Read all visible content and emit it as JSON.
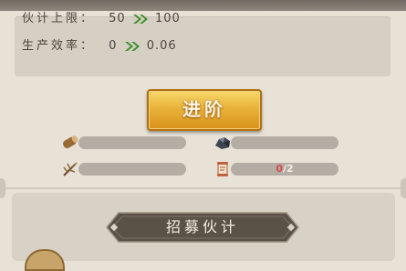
{
  "stats": {
    "partner_limit": {
      "label": "伙计上限：",
      "from": "50",
      "to": "100"
    },
    "production_efficiency": {
      "label": "生产效率：",
      "from": "0",
      "to": "0.06"
    }
  },
  "advance_button": {
    "label": "进阶"
  },
  "resources": [
    {
      "name": "wood",
      "icon": "wood-log-icon",
      "text": "",
      "current": "",
      "required": ""
    },
    {
      "name": "ore",
      "icon": "ore-icon",
      "text": "",
      "current": "",
      "required": ""
    },
    {
      "name": "herb",
      "icon": "herb-icon",
      "text": "",
      "current": "",
      "required": ""
    },
    {
      "name": "scroll",
      "icon": "scroll-icon",
      "current": "0",
      "required": "/2"
    }
  ],
  "recruit_button": {
    "label": "招募伙计"
  },
  "colors": {
    "arrow_green": "#3f8f2c",
    "gold_button": "#e9b23a",
    "enough_text": "#52c23d",
    "lacking_text": "#d94a4a",
    "recruit_button_bg": "#5a5247"
  }
}
